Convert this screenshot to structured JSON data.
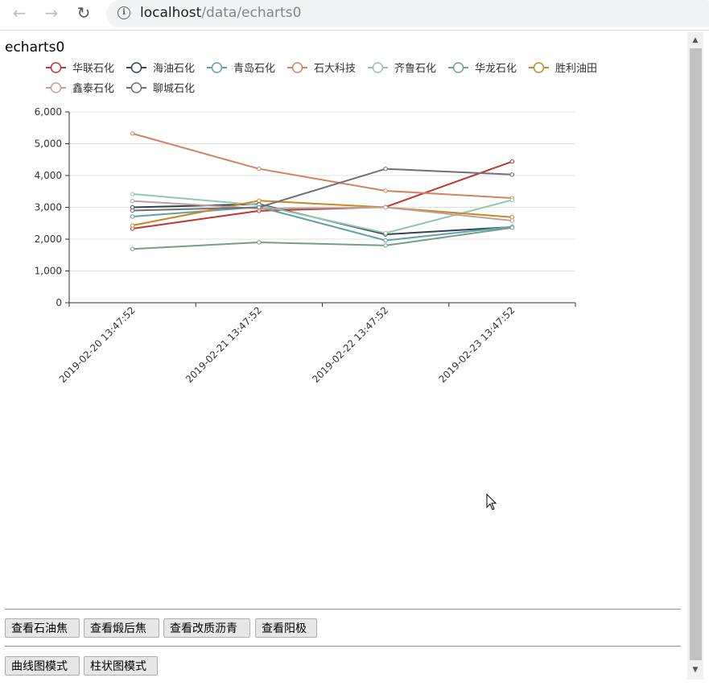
{
  "browser": {
    "back_icon": "arrow-left-icon",
    "forward_icon": "arrow-right-icon",
    "reload_icon": "reload-icon",
    "info_icon": "info-icon",
    "url_host": "localhost",
    "url_path": "/data/echarts0"
  },
  "page": {
    "title": "echarts0"
  },
  "chart_data": {
    "type": "line",
    "title": "",
    "xlabel": "",
    "ylabel": "",
    "ylim": [
      0,
      6000
    ],
    "y_ticks": [
      "0",
      "1,000",
      "2,000",
      "3,000",
      "4,000",
      "5,000",
      "6,000"
    ],
    "grid": true,
    "legend_position": "top-left",
    "categories": [
      "2019-02-20 13:47:52",
      "2019-02-21 13:47:52",
      "2019-02-22 13:47:52",
      "2019-02-23 13:47:52"
    ],
    "series": [
      {
        "name": "华联石化",
        "color": "#c23531",
        "values": [
          2330,
          2890,
          3010,
          4440
        ]
      },
      {
        "name": "海油石化",
        "color": "#2f4554",
        "values": [
          3000,
          3100,
          2150,
          2380
        ]
      },
      {
        "name": "青岛石化",
        "color": "#61a0a8",
        "values": [
          2710,
          3010,
          1960,
          2390
        ]
      },
      {
        "name": "石大科技",
        "color": "#d48265",
        "values": [
          5320,
          4210,
          3520,
          3290
        ]
      },
      {
        "name": "齐鲁石化",
        "color": "#91c7ae",
        "values": [
          3420,
          3070,
          2190,
          3230
        ]
      },
      {
        "name": "华龙石化",
        "color": "#749f83",
        "values": [
          1690,
          1900,
          1800,
          2360
        ]
      },
      {
        "name": "胜利油田",
        "color": "#ca8622",
        "values": [
          2430,
          3210,
          3000,
          2690
        ]
      },
      {
        "name": "鑫泰石化",
        "color": "#bda29a",
        "values": [
          3200,
          2960,
          3000,
          2580
        ]
      },
      {
        "name": "聊城石化",
        "color": "#6e7074",
        "values": [
          2900,
          3000,
          4210,
          4030
        ]
      }
    ]
  },
  "buttons_row1": [
    {
      "label": "查看石油焦"
    },
    {
      "label": "查看煅后焦"
    },
    {
      "label": "查看改质沥青"
    },
    {
      "label": "查看阳极"
    }
  ],
  "buttons_row2": [
    {
      "label": "曲线图模式"
    },
    {
      "label": "柱状图模式"
    }
  ],
  "scrollbar": {
    "up_icon": "scroll-up-icon",
    "down_icon": "scroll-down-icon"
  }
}
